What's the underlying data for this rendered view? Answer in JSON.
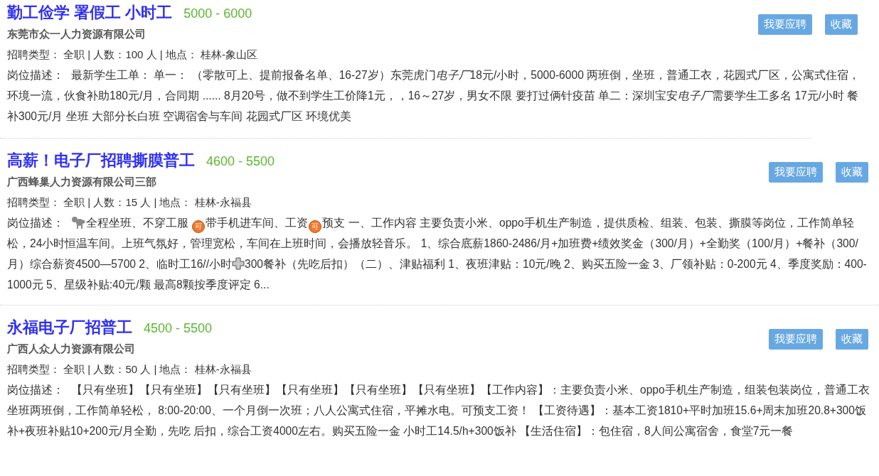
{
  "jobs": [
    {
      "title": "勤工俭学 署假工 小时工",
      "salary": "5000 - 6000",
      "company": "东莞市众一人力资源有限公司",
      "meta": "招聘类型： 全职 | 人数：100 人 | 地点： 桂林-象山区",
      "desc_label": "岗位描述：",
      "desc": [
        {
          "kind": "text",
          "text": "最新学生工单： 单一： （零散可上、提前报备名单、16-27岁）东莞虎门"
        },
        {
          "kind": "italic",
          "text": "电子厂"
        },
        {
          "kind": "text",
          "text": "18元/小时，5000-6000 两班倒，坐班，普通工衣，花园式厂区，公寓式住宿，环境一流，伙食补助180元/月，合同期 ...... 8月20号，做不到学生工价降1元，，16～27岁，男女不限 要打过俩针疫苗 单二：深圳宝安"
        },
        {
          "kind": "italic",
          "text": "电子厂"
        },
        {
          "kind": "text",
          "text": "需要学生工多名 17元/小时 餐补300元/月 坐班 大部分长白班 空调宿舍与车间 花园式厂区 环境优美"
        }
      ],
      "apply": "我要应聘",
      "save": "收藏"
    },
    {
      "title": "高薪！电子厂招聘撕膜普工",
      "salary": "4600 - 5500",
      "company": "广西蜂巢人力资源有限公司三部",
      "meta": "招聘类型： 全职 | 人数：15 人 | 地点： 桂林-永福县",
      "desc_label": "岗位描述：",
      "desc": [
        {
          "kind": "dog"
        },
        {
          "kind": "text",
          "text": "全程坐班、不穿工服 "
        },
        {
          "kind": "badge",
          "text": "可"
        },
        {
          "kind": "text",
          "text": "带手机进车间、工资"
        },
        {
          "kind": "badge",
          "text": "可"
        },
        {
          "kind": "text",
          "text": "预支 一、工作内容 主要负责小米、oppo手机生产制造，提供质检、组装、包装、撕膜等岗位，工作简单轻松，24小时恒温车间。上班气氛好，管理宽松，车间在上班时间，会播放轻音乐。 1、综合底薪1860-2486/月+加班费+绩效奖金（300/月）+全勤奖（100/月）+餐补（300/月）综合薪资4500—5700 2、临时工16//小时"
        },
        {
          "kind": "plus"
        },
        {
          "kind": "text",
          "text": "300餐补（先吃后扣）（二）、津贴福利 1、夜班津贴：10元/晚 2、购买五险一金 3、厂领补贴：0-200元 4、季度奖励：400-1000元 5、星级补贴:40元/颗 最高8颗按季度评定 6..."
        }
      ],
      "apply": "我要应聘",
      "save": "收藏"
    },
    {
      "title": "永福电子厂招普工",
      "salary": "4500 - 5500",
      "company": "广西人众人力资源有限公司",
      "meta": "招聘类型： 全职 | 人数：50 人 | 地点： 桂林-永福县",
      "desc_label": "岗位描述：",
      "desc": [
        {
          "kind": "text",
          "text": "【只有坐班】【只有坐班】【只有坐班】【只有坐班】【只有坐班】【只有坐班】【工作内容】：主要负责小米、oppo手机生产制造，组装包装岗位，普通工衣坐班两班倒，工作简单轻松， 8:00-20:00、一个月倒一次班；八人公寓式住宿，平摊水电。可预支工资！ 【工资待遇】：基本工资1810+平时加班15.6+周末加班20.8+300饭补+夜班补贴10+200元/月全勤，先吃 后扣，综合工资4000左右。购买五险一金 小时工14.5/h+300饭补 【生活住宿】：包住宿，8人间公寓宿舍，食堂7元一餐"
        }
      ],
      "apply": "我要应聘",
      "save": "收藏"
    }
  ]
}
